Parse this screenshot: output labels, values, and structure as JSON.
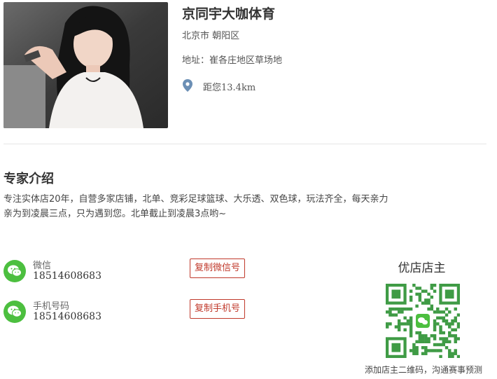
{
  "store": {
    "name": "京同宇大咖体育",
    "city": "北京市 朝阳区",
    "address": "地址：崔各庄地区草场地",
    "distance": "距您13.4km"
  },
  "intro": {
    "title": "专家介绍",
    "line1": "专注实体店20年，自营多家店铺，北单、竞彩足球篮球、大乐透、双色球，玩法齐全，每天亲力",
    "line2": "亲为到凌晨三点，只为遇到您。北单截止到凌晨3点哟~"
  },
  "contacts": {
    "wechat": {
      "label": "微信",
      "value": "18514608683",
      "button": "复制微信号"
    },
    "phone": {
      "label": "手机号码",
      "value": "18514608683",
      "button": "复制手机号"
    }
  },
  "owner": {
    "title": "优店店主",
    "qr_caption": "添加店主二维码，沟通赛事预测"
  },
  "icons": {
    "location": "location-pin-icon",
    "wechat": "wechat-icon"
  },
  "colors": {
    "accent": "#c0392b",
    "wechat_green": "#4cbf3f",
    "pin_blue": "#6b8fb5"
  }
}
